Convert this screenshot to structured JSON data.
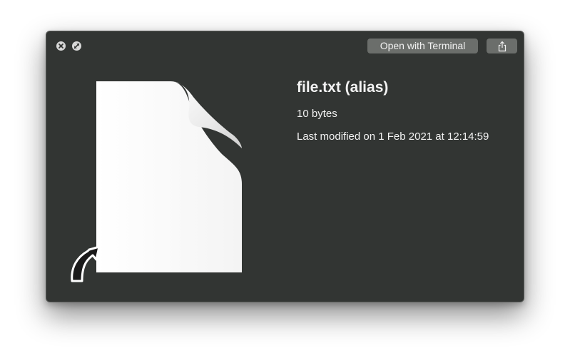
{
  "window": {
    "buttons": {
      "close_icon": "close-icon",
      "fullscreen_icon": "fullscreen-icon",
      "open_with_label": "Open with Terminal",
      "share_icon": "share-icon"
    }
  },
  "file": {
    "title": "file.txt (alias)",
    "size": "10 bytes",
    "modified": "Last modified on 1 Feb 2021 at 12:14:59",
    "icon": "document-alias-icon"
  },
  "colors": {
    "window_bg": "#323533",
    "button_bg": "#6b6e6b",
    "text": "#f2f2f2"
  }
}
